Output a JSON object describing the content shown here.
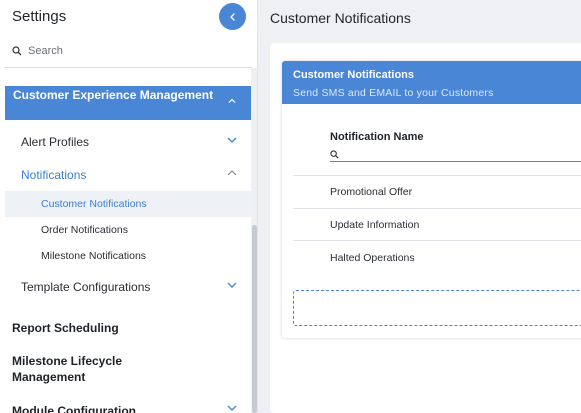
{
  "sidebar": {
    "title": "Settings",
    "search_placeholder": "Search",
    "section": "Customer Experience Management",
    "items": {
      "alert_profiles": "Alert Profiles",
      "notifications": "Notifications",
      "customer_notifications": "Customer Notifications",
      "order_notifications": "Order Notifications",
      "milestone_notifications": "Milestone Notifications",
      "template_configurations": "Template Configurations",
      "report_scheduling": "Report Scheduling",
      "milestone_lifecycle": "Milestone Lifecycle Management",
      "module_configuration": "Module Configuration"
    }
  },
  "main": {
    "title": "Customer Notifications",
    "panel": {
      "title": "Customer Notifications",
      "subtitle": "Send SMS and EMAIL to your Customers",
      "column_header": "Notification Name",
      "rows": [
        "Promotional Offer",
        "Update Information",
        "Halted Operations"
      ]
    }
  },
  "colors": {
    "accent": "#4a86d6",
    "active_text": "#3d7fd3"
  }
}
